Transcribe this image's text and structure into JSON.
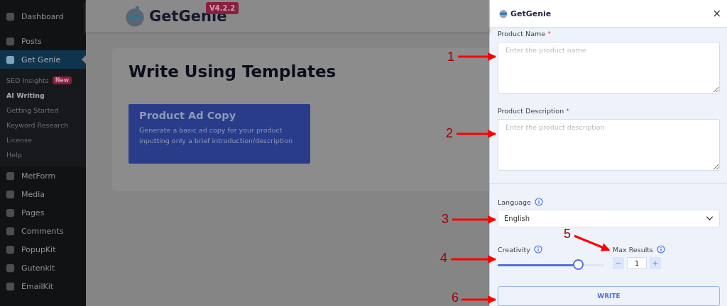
{
  "sidebar": {
    "items": [
      {
        "label": "Dashboard",
        "selected": false
      },
      {
        "label": "Posts",
        "selected": false
      },
      {
        "label": "Get Genie",
        "selected": true,
        "children": [
          {
            "label": "SEO Insights",
            "badge": "New",
            "selected": false
          },
          {
            "label": "AI Writing",
            "selected": true
          },
          {
            "label": "Getting Started",
            "selected": false
          },
          {
            "label": "Keyword Research",
            "selected": false
          },
          {
            "label": "License",
            "selected": false
          },
          {
            "label": "Help",
            "selected": false
          }
        ]
      },
      {
        "label": "MetForm",
        "selected": false
      },
      {
        "label": "Media",
        "selected": false
      },
      {
        "label": "Pages",
        "selected": false
      },
      {
        "label": "Comments",
        "selected": false
      },
      {
        "label": "PopupKit",
        "selected": false
      },
      {
        "label": "Gutenkit",
        "selected": false
      },
      {
        "label": "EmailKit",
        "selected": false
      }
    ]
  },
  "header": {
    "logo": "GetGenie",
    "version": "V4.2.2"
  },
  "page": {
    "title": "Write Using Templates",
    "template": {
      "title": "Product Ad Copy",
      "description": "Generate a basic ad copy for your product inputting only a brief introduction/description"
    }
  },
  "panel": {
    "logo": "GetGenie",
    "close": "×",
    "fields": [
      {
        "label": "Product Name",
        "required_mark": "*",
        "placeholder": "Enter the product name"
      },
      {
        "label": "Product Description",
        "required_mark": "*",
        "placeholder": "Enter the product description"
      }
    ],
    "language": {
      "label": "Language",
      "value": "English"
    },
    "creativity": {
      "label": "Creativity",
      "level": 0.75
    },
    "max_results": {
      "label": "Max Results",
      "minus": "−",
      "value": "1",
      "plus": "+"
    },
    "write_button": "WRITE"
  },
  "annotations": [
    {
      "label": "1"
    },
    {
      "label": "2"
    },
    {
      "label": "3"
    },
    {
      "label": "4"
    },
    {
      "label": "5"
    },
    {
      "label": "6"
    }
  ]
}
